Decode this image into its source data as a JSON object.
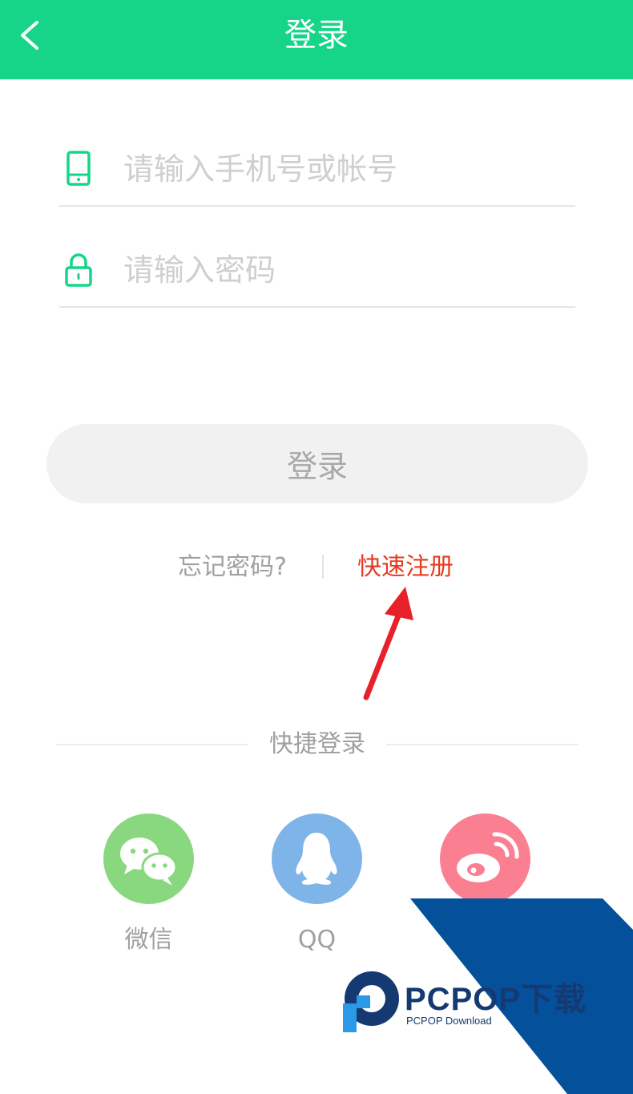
{
  "header": {
    "title": "登录"
  },
  "form": {
    "phone_placeholder": "请输入手机号或帐号",
    "password_placeholder": "请输入密码",
    "login_label": "登录"
  },
  "links": {
    "forgot_label": "忘记密码?",
    "register_label": "快速注册"
  },
  "quick_login": {
    "label": "快捷登录",
    "providers": [
      {
        "label": "微信",
        "icon": "wechat-icon"
      },
      {
        "label": "QQ",
        "icon": "qq-icon"
      },
      {
        "label": "",
        "icon": "weibo-icon"
      }
    ]
  },
  "watermark": {
    "name": "PCPOP下载",
    "sub": "PCPOP Download"
  },
  "colors": {
    "accent": "#16d589",
    "register": "#e53b1e",
    "wechat": "#89d87f",
    "qq": "#7fb4e8",
    "weibo": "#f97f91",
    "annotation_arrow": "#e8202a"
  }
}
